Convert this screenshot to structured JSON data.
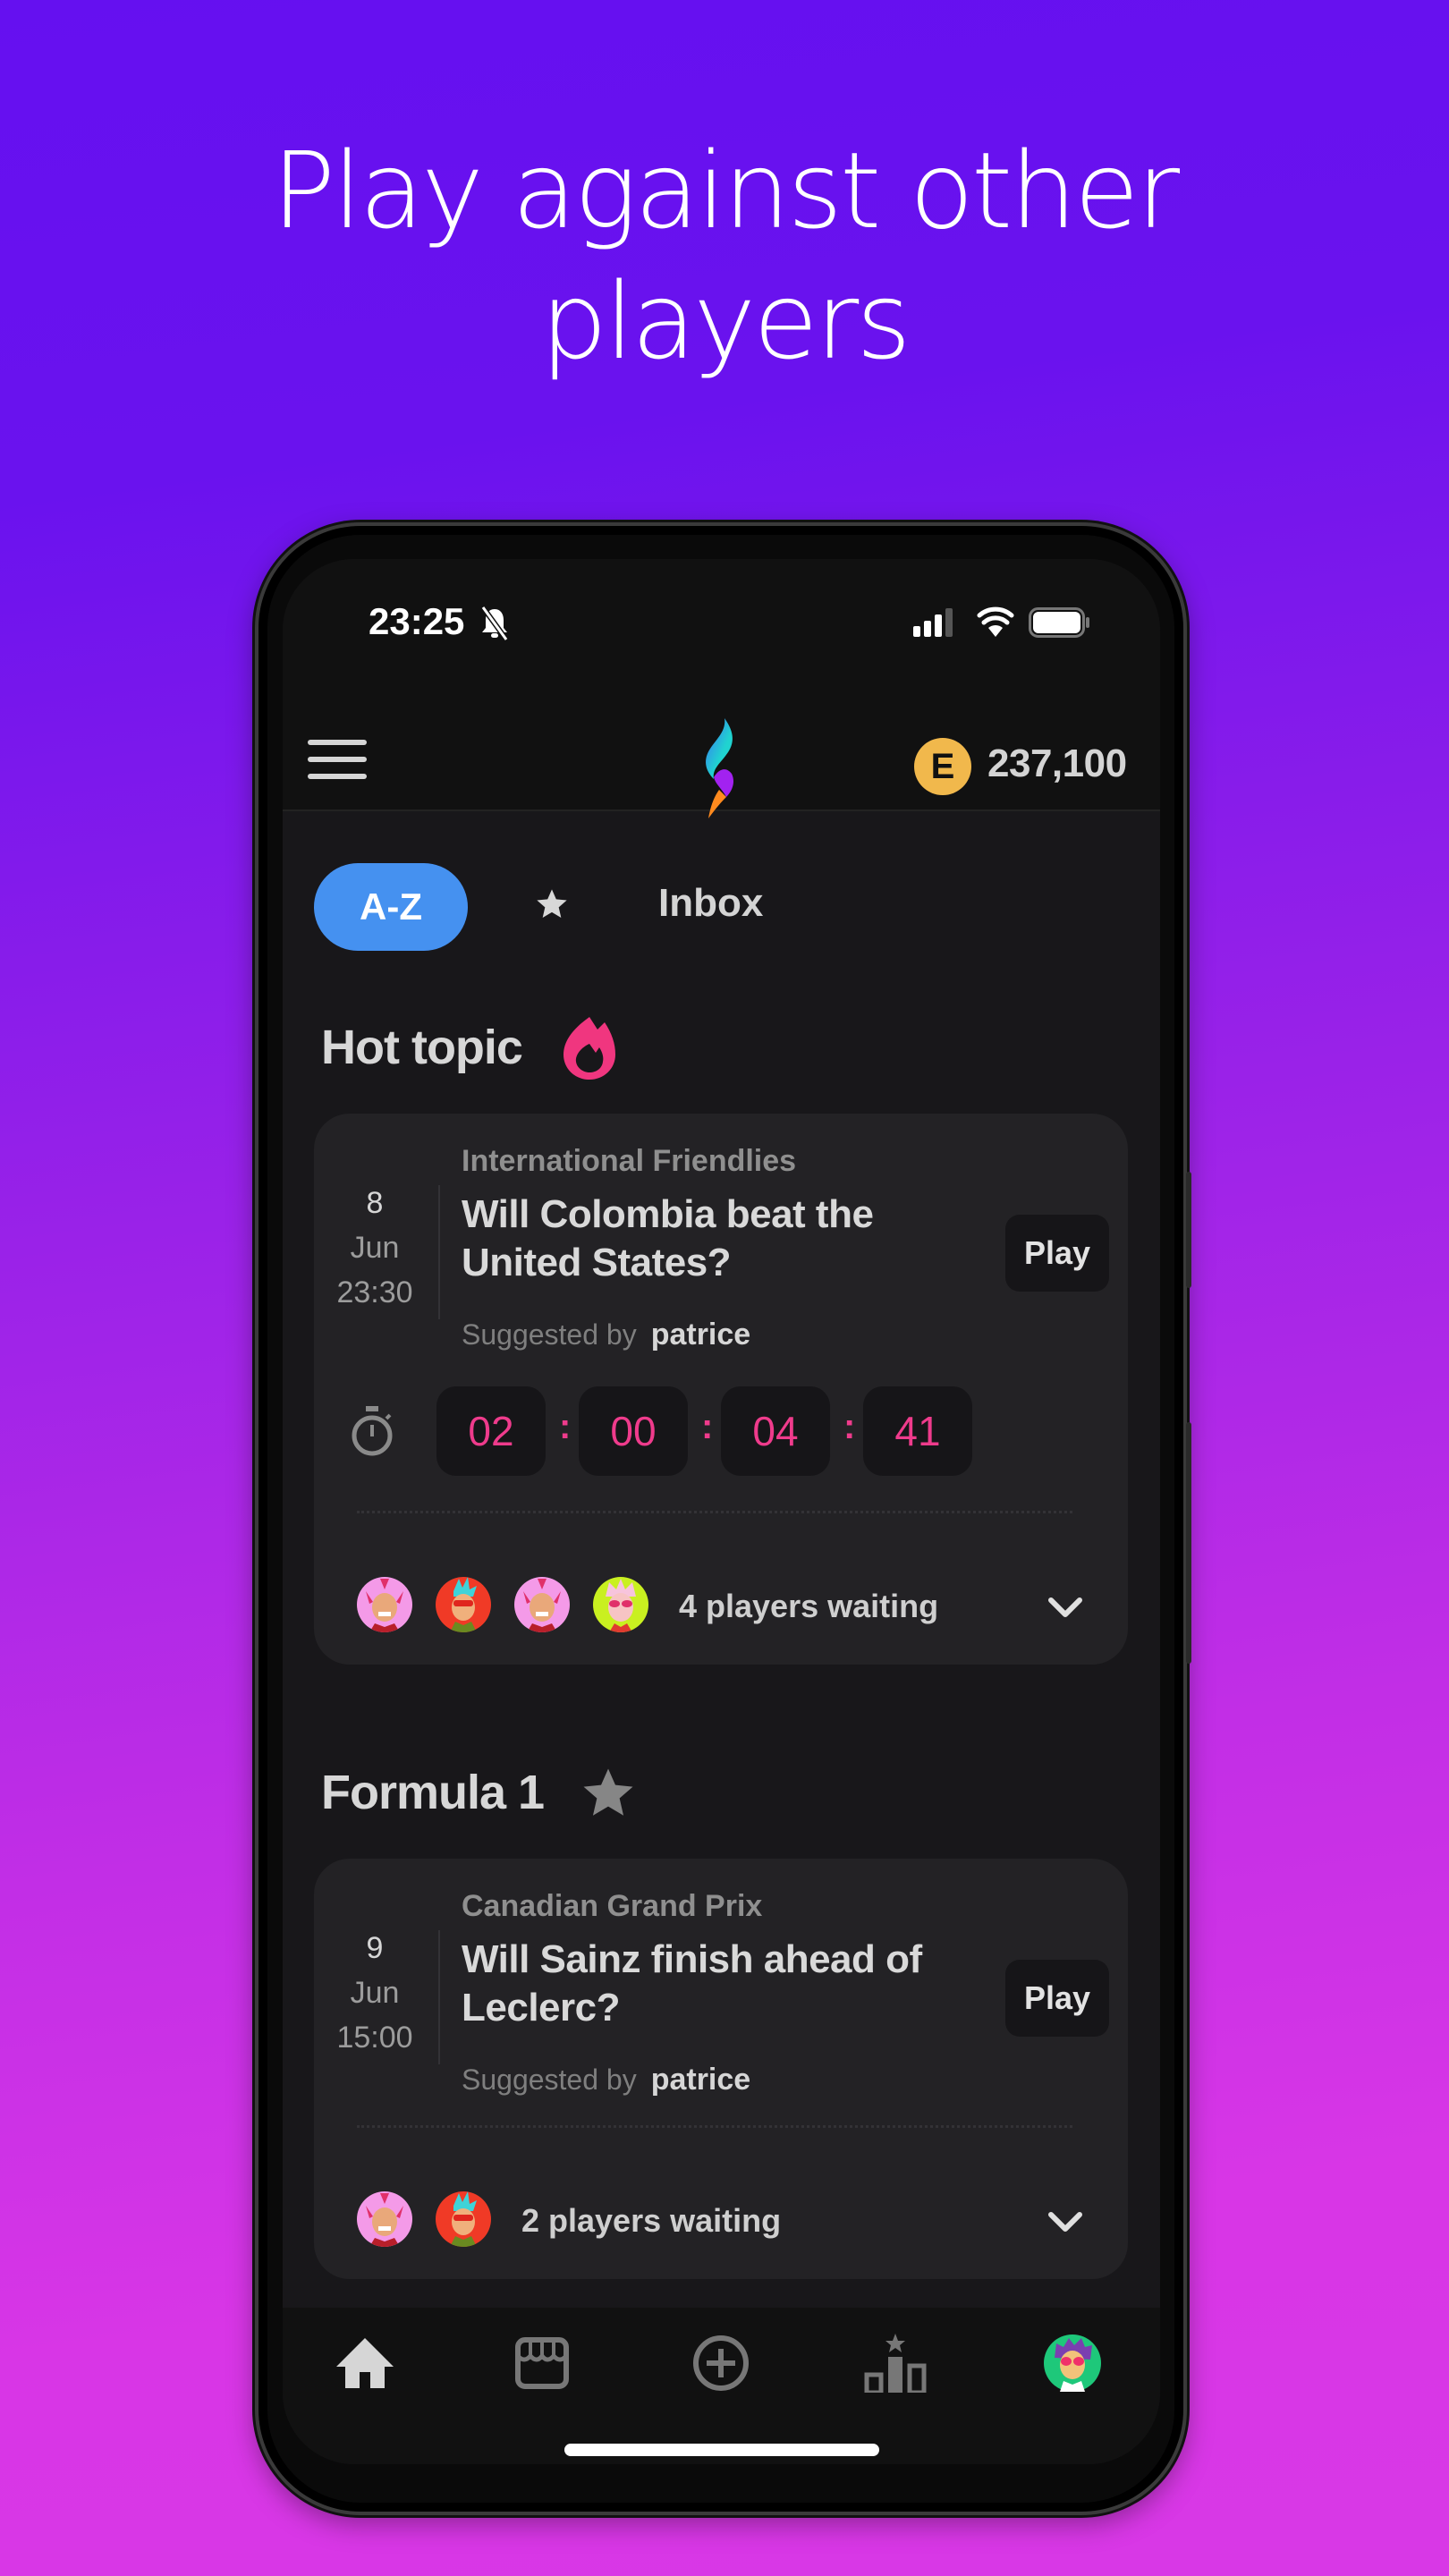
{
  "headline": {
    "line1": "Play against other",
    "line2": "players"
  },
  "status_bar": {
    "time": "23:25",
    "icons": [
      "bell-muted-icon",
      "signal-icon",
      "wifi-icon",
      "battery-icon"
    ]
  },
  "app_bar": {
    "menu_icon": "hamburger-menu-icon",
    "logo": "flame-logo",
    "coin_symbol": "E",
    "coin_balance": "237,100"
  },
  "tabs": [
    {
      "label": "A-Z",
      "active": true
    },
    {
      "label": "★",
      "icon": "star-icon",
      "active": false
    },
    {
      "label": "Inbox",
      "active": false
    }
  ],
  "sections": [
    {
      "title": "Hot topic",
      "icon": "fire-icon",
      "icon_color": "#f0367f",
      "card": {
        "date_day": "8",
        "date_month": "Jun",
        "date_time": "23:30",
        "category": "International Friendlies",
        "question": "Will Colombia beat the United States?",
        "suggested_label": "Suggested by",
        "suggested_user": "patrice",
        "play_label": "Play",
        "countdown": [
          "02",
          "00",
          "04",
          "41"
        ],
        "countdown_separator": ":",
        "players_waiting": "4 players waiting",
        "avatars": [
          "pink-mohawk",
          "red-cyan-hair",
          "pink-mohawk",
          "lime-glasses"
        ]
      }
    },
    {
      "title": "Formula 1",
      "icon": "star-icon",
      "card": {
        "date_day": "9",
        "date_month": "Jun",
        "date_time": "15:00",
        "category": "Canadian Grand Prix",
        "question": "Will Sainz finish ahead of Leclerc?",
        "suggested_label": "Suggested by",
        "suggested_user": "patrice",
        "play_label": "Play",
        "players_waiting": "2 players waiting",
        "avatars": [
          "pink-mohawk",
          "red-cyan-hair"
        ]
      }
    }
  ],
  "bottom_nav": [
    {
      "name": "home",
      "icon": "home-icon",
      "active": true
    },
    {
      "name": "shop",
      "icon": "store-icon",
      "active": false
    },
    {
      "name": "create",
      "icon": "plus-circle-icon",
      "active": false
    },
    {
      "name": "leaderboard",
      "icon": "podium-icon",
      "active": false
    },
    {
      "name": "profile",
      "icon": "avatar-icon",
      "active": false
    }
  ],
  "colors": {
    "accent_blue": "#4591f0",
    "countdown_pink": "#ef3b8c",
    "coin_gold": "#f1b84c",
    "bg_gradient_top": "#6510f0",
    "bg_gradient_bottom": "#d838e6"
  }
}
